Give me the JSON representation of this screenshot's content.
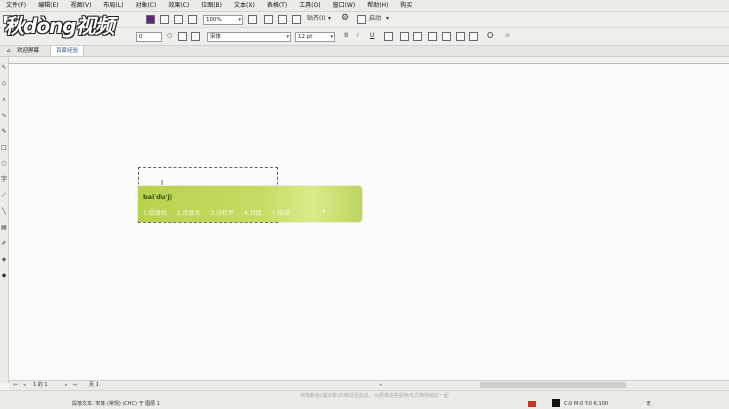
{
  "menu": [
    "文件(F)",
    "编辑(E)",
    "视图(V)",
    "布局(L)",
    "对象(C)",
    "效果(C)",
    "位图(B)",
    "文本(X)",
    "表格(T)",
    "工具(O)",
    "窗口(W)",
    "帮助(H)",
    "购买"
  ],
  "toolbar1": {
    "zoom_value": "100%",
    "snap_label": "贴齐(I)",
    "launch_label": "启动"
  },
  "toolbar2": {
    "x_value": "0",
    "font_name": "宋体",
    "font_size": "12 pt",
    "bold": "B",
    "italic": "I",
    "underline": "U"
  },
  "tabs": [
    "欢迎屏幕",
    "百家经验"
  ],
  "ime": {
    "pinyin": "bai'du'j|",
    "candidates": [
      "1.摆渡机",
      "2.百度及",
      "3.白杜芹",
      "4.百度",
      "5.摆渡"
    ]
  },
  "pagebar": {
    "page_indicator": "1 的 1",
    "page_tab": "页 1"
  },
  "statusbar": {
    "hint": "拖曳颜色(或对象)并移动至此处，以便将这些颜色与文档存储在一起",
    "object_info": "段落文本: 宋体 (常规) (CHC) 于 图层 1",
    "color_info": "C:0 M:0 Y:0 K:100",
    "none_label": "无"
  },
  "watermark": "秋dòng视频",
  "colors": {
    "ime_green": "#c4dc62",
    "tab_active_text": "#2a4f8a"
  }
}
